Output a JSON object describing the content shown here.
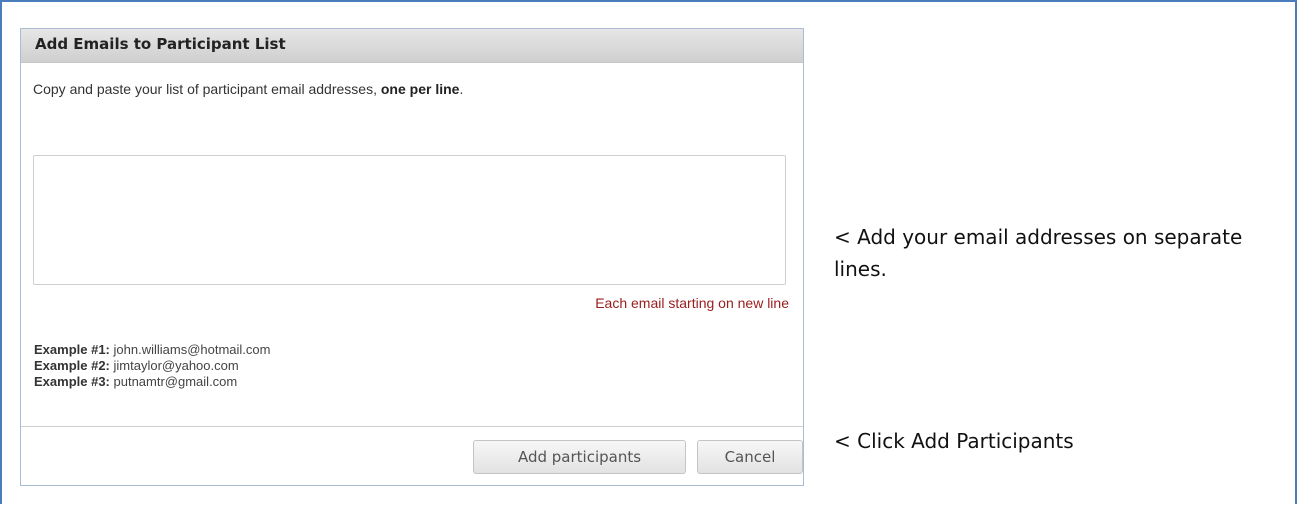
{
  "dialog": {
    "title": "Add Emails to Participant List",
    "instruction_prefix": "Copy and paste your list of participant email addresses, ",
    "instruction_bold": "one per line",
    "instruction_suffix": ".",
    "textarea_value": "",
    "hint": "Each email starting on new line",
    "examples": [
      {
        "label": "Example #1:",
        "value": "john.williams@hotmail.com"
      },
      {
        "label": "Example #2:",
        "value": "jimtaylor@yahoo.com"
      },
      {
        "label": "Example #3:",
        "value": "putnamtr@gmail.com"
      }
    ],
    "add_button": "Add participants",
    "cancel_button": "Cancel"
  },
  "annotations": {
    "note_1": "< Add your email addresses on separate lines.",
    "note_2": "< Click Add Participants"
  },
  "colors": {
    "frame_border": "#4a7dbb",
    "hint_text": "#9b1c1c"
  }
}
